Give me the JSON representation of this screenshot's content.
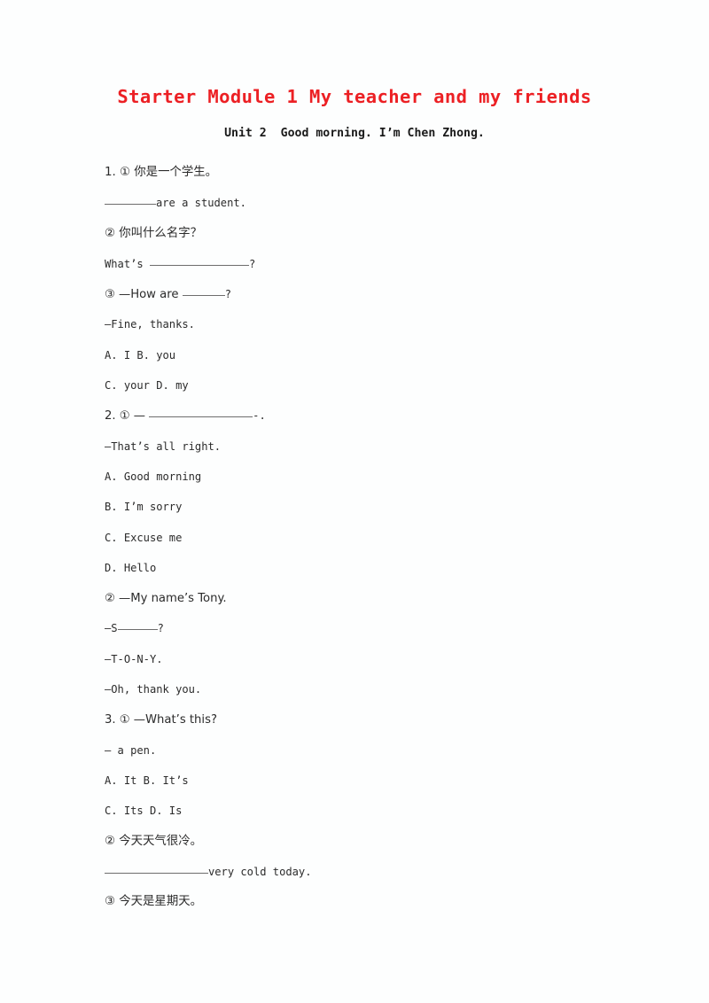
{
  "document": {
    "title": "Starter Module 1 My teacher and my friends",
    "subtitle": "Unit 2  Good morning. I’m Chen Zhong.",
    "title_color": "#ec2024",
    "body_color": "#2b2b2b",
    "background_color": "#fdfefe"
  },
  "lines": [
    {
      "id": "q1-item1-cn",
      "text": "1. ① 你是一个学生。"
    },
    {
      "id": "q1-item1-blank",
      "pre": "",
      "post": "are a student."
    },
    {
      "id": "q1-item2-cn",
      "text": "② 你叫什么名字？"
    },
    {
      "id": "q1-item2-blank",
      "pre": "What’s ",
      "post": "?"
    },
    {
      "id": "q1-item3-blank",
      "pre": "③ —How are ",
      "post": "?"
    },
    {
      "id": "q1-item3-answer",
      "text": "—Fine, thanks."
    },
    {
      "id": "q1-options-ab",
      "text": "A. I B. you"
    },
    {
      "id": "q1-options-cd",
      "text": "C. your D. my"
    },
    {
      "id": "q2-item1-blank",
      "pre": "2. ① — ",
      "post": "-."
    },
    {
      "id": "q2-item1-answer",
      "text": "—That’s all right."
    },
    {
      "id": "q2-option-a",
      "text": "A. Good morning"
    },
    {
      "id": "q2-option-b",
      "text": "B. I’m sorry"
    },
    {
      "id": "q2-option-c",
      "text": "C. Excuse me"
    },
    {
      "id": "q2-option-d",
      "text": "D. Hello"
    },
    {
      "id": "q2-item2-prompt",
      "text": "② —My name’s Tony."
    },
    {
      "id": "q2-item2-blank",
      "pre": "—S",
      "post": "?"
    },
    {
      "id": "q2-item2-spell",
      "text": "—T-O-N-Y."
    },
    {
      "id": "q2-item2-thanks",
      "text": "—Oh, thank you."
    },
    {
      "id": "q3-item1-prompt",
      "text": "3. ① —What’s this?"
    },
    {
      "id": "q3-item1-answer",
      "text": "— a pen."
    },
    {
      "id": "q3-options-ab",
      "text": "A. It B. It’s"
    },
    {
      "id": "q3-options-cd",
      "text": "C. Its D. Is"
    },
    {
      "id": "q3-item2-cn",
      "text": "② 今天天气很冷。"
    },
    {
      "id": "q3-item2-blank",
      "pre": "",
      "post": "very cold today."
    },
    {
      "id": "q3-item3-cn",
      "text": "③ 今天是星期天。"
    }
  ]
}
